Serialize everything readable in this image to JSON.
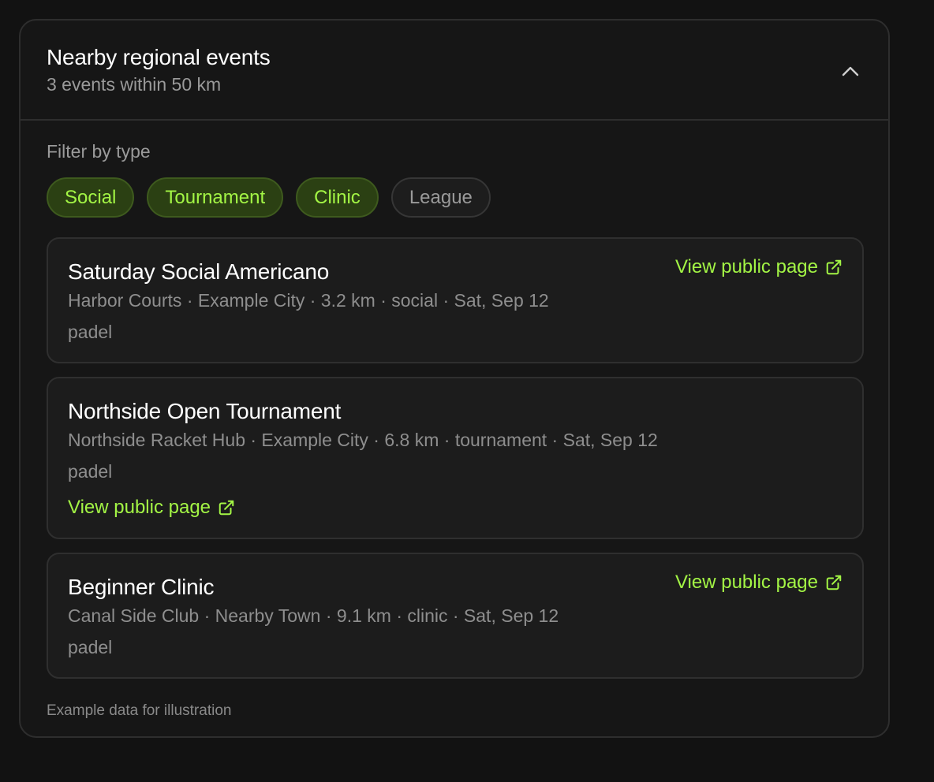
{
  "panel": {
    "title": "Nearby regional events",
    "subtitle": "3 events within 50 km",
    "collapse_icon": "chevron-up-icon"
  },
  "filters": {
    "label": "Filter by type",
    "chips": [
      {
        "label": "Social",
        "active": true
      },
      {
        "label": "Tournament",
        "active": true
      },
      {
        "label": "Clinic",
        "active": true
      },
      {
        "label": "League",
        "active": false
      }
    ]
  },
  "events": [
    {
      "title": "Saturday Social Americano",
      "meta": "Harbor Courts · Example City · 3.2 km · social · Sat, Sep 12",
      "sport": "padel",
      "link_label": "View public page",
      "link_icon": "external-link-icon"
    },
    {
      "title": "Northside Open Tournament",
      "meta": "Northside Racket Hub · Example City · 6.8 km · tournament · Sat, Sep 12",
      "sport": "padel",
      "link_label": "View public page",
      "link_icon": "external-link-icon"
    },
    {
      "title": "Beginner Clinic",
      "meta": "Canal Side Club · Nearby Town · 9.1 km · clinic · Sat, Sep 12",
      "sport": "padel",
      "link_label": "View public page",
      "link_icon": "external-link-icon"
    }
  ],
  "footnote": "Example data for illustration",
  "colors": {
    "accent": "#a3f545",
    "chip_active_bg": "#2b4013",
    "background": "#121212",
    "card_bg": "#1c1c1c",
    "muted_text": "#9a9a9a"
  }
}
